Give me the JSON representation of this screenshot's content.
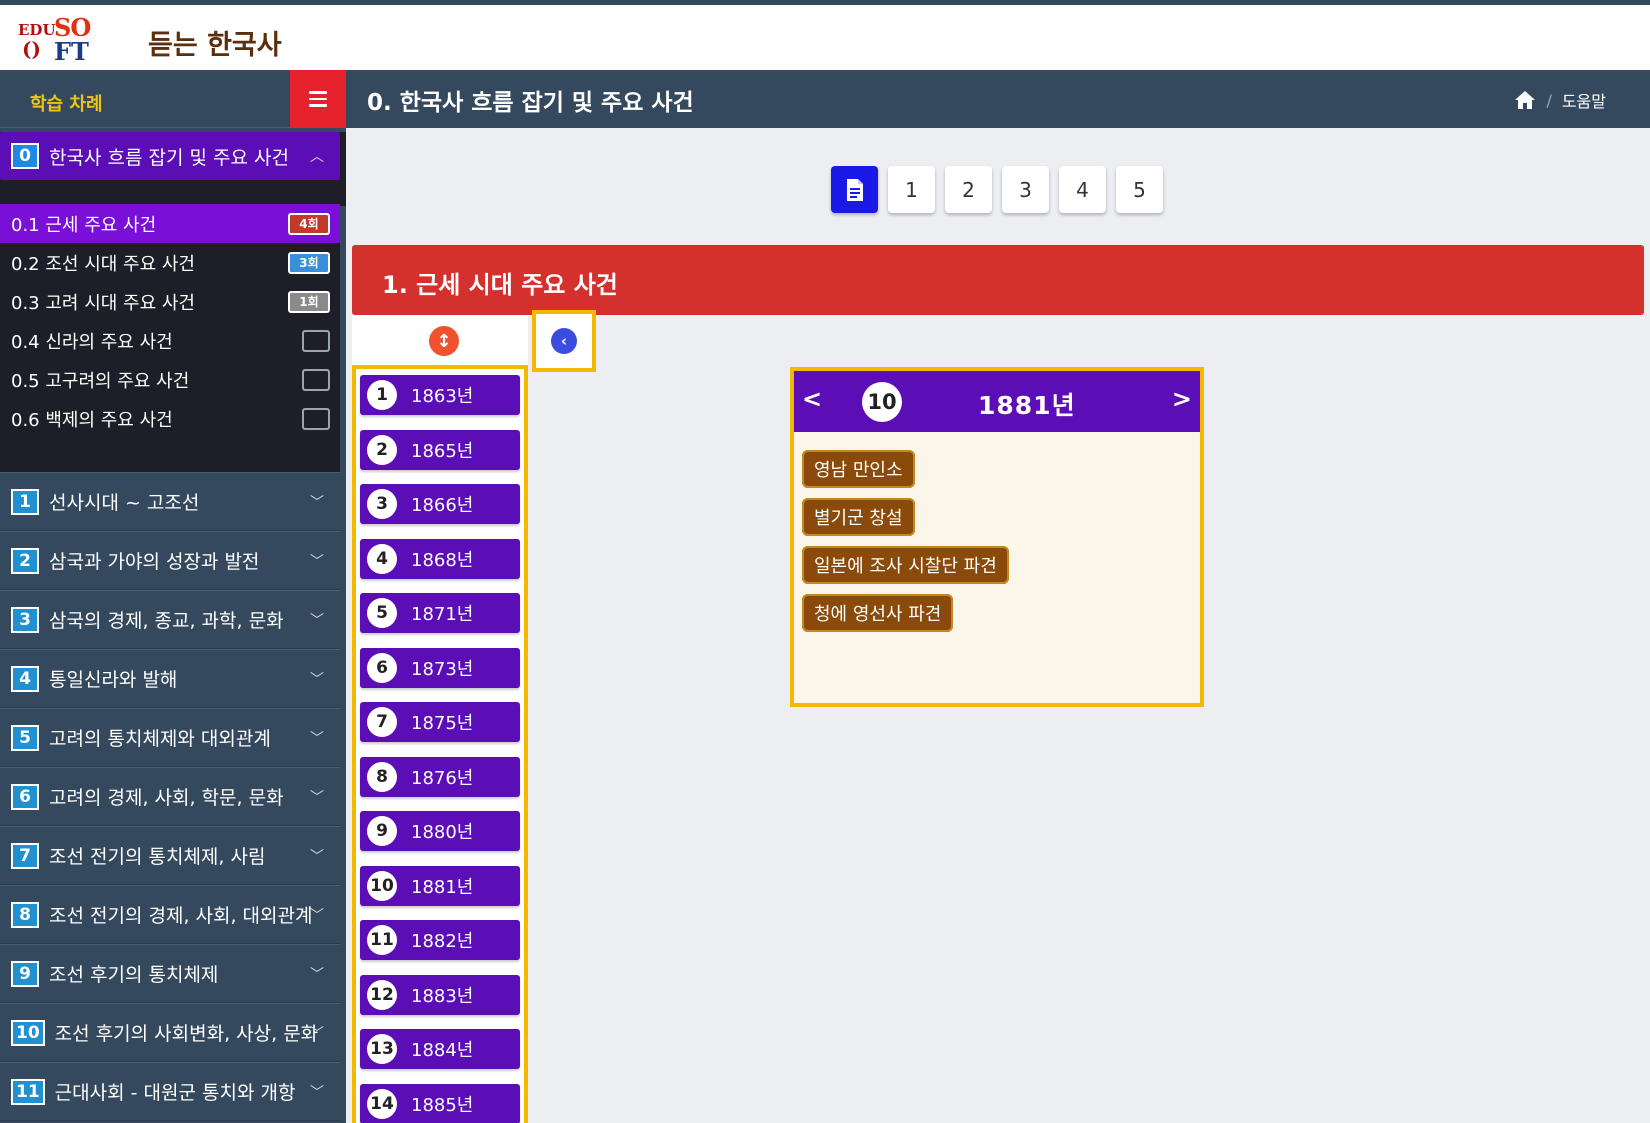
{
  "app": {
    "logo_line1": "EDU",
    "logo_line2": "SO",
    "logo_line3": "()",
    "logo_line4": "FT",
    "title": "듣는 한국사"
  },
  "sidebar": {
    "header": "학습 차례",
    "active_chapter": {
      "num": "0",
      "label": "한국사 흐름 잡기 및 주요 사건"
    },
    "sub_items": [
      {
        "label": "0.1 근세 주요 사건",
        "badge": "4회",
        "badge_color": "#c0392b"
      },
      {
        "label": "0.2 조선 시대 주요 사건",
        "badge": "3회",
        "badge_color": "#3a8fd8"
      },
      {
        "label": "0.3 고려 시대 주요 사건",
        "badge": "1회",
        "badge_color": "#8a8a8a"
      },
      {
        "label": "0.4 신라의 주요 사건",
        "badge": ""
      },
      {
        "label": "0.5 고구려의 주요 사건",
        "badge": ""
      },
      {
        "label": "0.6 백제의 주요 사건",
        "badge": ""
      }
    ],
    "chapters": [
      {
        "num": "1",
        "label": "선사시대 ~ 고조선"
      },
      {
        "num": "2",
        "label": "삼국과 가야의 성장과 발전"
      },
      {
        "num": "3",
        "label": "삼국의 경제, 종교, 과학, 문화"
      },
      {
        "num": "4",
        "label": "통일신라와 발해"
      },
      {
        "num": "5",
        "label": "고려의 통치체제와 대외관계"
      },
      {
        "num": "6",
        "label": "고려의 경제, 사회, 학문, 문화"
      },
      {
        "num": "7",
        "label": "조선 전기의 통치체제, 사림"
      },
      {
        "num": "8",
        "label": "조선 전기의 경제, 사회, 대외관계"
      },
      {
        "num": "9",
        "label": "조선 후기의 통치체제"
      },
      {
        "num": "10",
        "label": "조선 후기의 사회변화, 사상, 문화"
      },
      {
        "num": "11",
        "label": "근대사회 - 대원군 통치와 개항"
      }
    ]
  },
  "header": {
    "title": "0. 한국사 흐름 잡기 및 주요 사건",
    "help": "도움말",
    "separator": "/"
  },
  "pager": {
    "pages": [
      "1",
      "2",
      "3",
      "4",
      "5"
    ]
  },
  "section": {
    "title": "1. 근세 시대 주요 사건"
  },
  "years": [
    {
      "n": "1",
      "year": "1863년"
    },
    {
      "n": "2",
      "year": "1865년"
    },
    {
      "n": "3",
      "year": "1866년"
    },
    {
      "n": "4",
      "year": "1868년"
    },
    {
      "n": "5",
      "year": "1871년"
    },
    {
      "n": "6",
      "year": "1873년"
    },
    {
      "n": "7",
      "year": "1875년"
    },
    {
      "n": "8",
      "year": "1876년"
    },
    {
      "n": "9",
      "year": "1880년"
    },
    {
      "n": "10",
      "year": "1881년"
    },
    {
      "n": "11",
      "year": "1882년"
    },
    {
      "n": "12",
      "year": "1883년"
    },
    {
      "n": "13",
      "year": "1884년"
    },
    {
      "n": "14",
      "year": "1885년"
    }
  ],
  "detail": {
    "num": "10",
    "year": "1881년",
    "events": [
      "영남 만인소",
      "별기군 창설",
      "일본에 조사 시찰단 파견",
      "청에 영선사 파견"
    ]
  },
  "colors": {
    "sidebar_bg": "#34495e",
    "accent_purple": "#5b0eb5",
    "section_red": "#d4302e",
    "highlight_yellow": "#f5b800",
    "event_brown": "#8a4a0a"
  }
}
